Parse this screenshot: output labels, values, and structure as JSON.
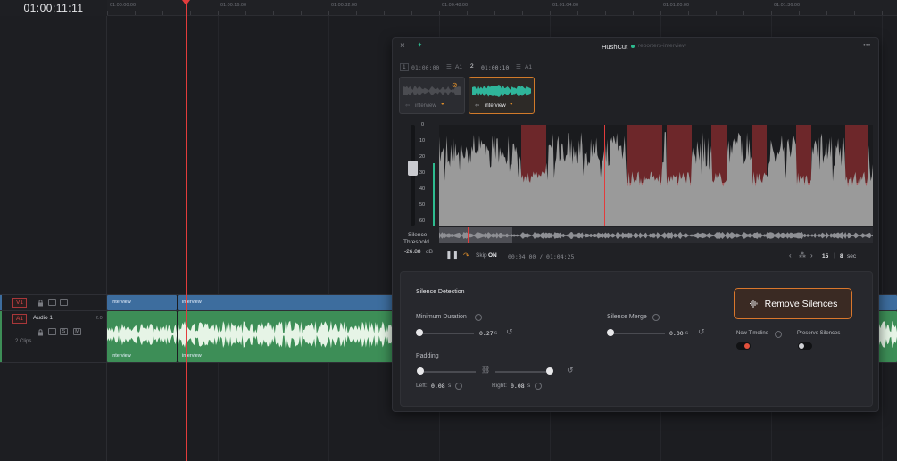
{
  "timeline": {
    "timecode": "01:00:11:11",
    "ruler_labels": [
      "01:00:00:00",
      "01:00:16:00",
      "01:00:32:00",
      "01:00:48:00",
      "01:01:04:00",
      "01:01:20:00",
      "01:01:36:00"
    ],
    "video_track": {
      "label": "V1"
    },
    "audio_track": {
      "label": "A1",
      "name": "Audio 1",
      "level": "2.0",
      "clips": "2 Clips",
      "solo": "S",
      "mute": "M"
    },
    "clip_names": [
      "interview",
      "interview",
      "interview",
      "interview"
    ],
    "colors": {
      "video_clip": "#3d6d9e",
      "audio_clip": "#3d8e57",
      "playhead": "#e23c3c"
    }
  },
  "panel": {
    "title": "HushCut",
    "subtitle": "reporters-interview",
    "menu": "•••",
    "tabs": [
      {
        "index": "1",
        "time": "01:00:00",
        "track": "A1",
        "clip": "interview",
        "selected": false
      },
      {
        "index": "2",
        "time": "01:00:10",
        "track": "A1",
        "clip": "interview",
        "selected": true
      }
    ],
    "meter_ticks": [
      "0",
      "10",
      "20",
      "30",
      "40",
      "50",
      "60"
    ],
    "threshold": {
      "label_1": "Silence",
      "label_2": "Threshold",
      "value": "-26.88",
      "unit": "dB",
      "fraction": 0.44
    },
    "transport": {
      "skip_label": "Skip",
      "skip_state": "ON",
      "position": "00:04:00 / 01:04:25",
      "zoom_value": "15",
      "zoom_sep": "|",
      "window_value": "8",
      "window_unit": "sec"
    },
    "silence_detection": {
      "title": "Silence Detection",
      "min_duration": {
        "label": "Minimum Duration",
        "value": "0.27",
        "unit": "s"
      },
      "silence_merge": {
        "label": "Silence Merge",
        "value": "0.00",
        "unit": "s"
      },
      "padding": {
        "label": "Padding",
        "left_label": "Left:",
        "left_value": "0.08",
        "right_label": "Right:",
        "right_value": "0.08",
        "unit": "s"
      }
    },
    "remove_button": "Remove Silences",
    "new_timeline": {
      "label": "New Timeline",
      "on": true
    },
    "preserve_silences": {
      "label": "Preserve Silences",
      "on": false
    },
    "colors": {
      "accent": "#d9772c",
      "silence_region": "#8a2c2f",
      "waveform": "#9a9a9a",
      "status_dot": "#2dbb8f"
    }
  }
}
